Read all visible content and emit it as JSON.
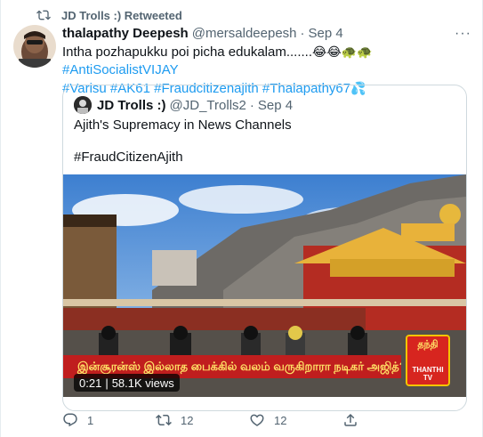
{
  "retweet": {
    "label": "JD Trolls :) Retweeted"
  },
  "tweet": {
    "author_name": "thalapathy Deepesh",
    "author_handle": "@mersaldeepesh",
    "separator": "·",
    "date": "Sep 4",
    "more": "···",
    "text_plain": "Intha pozhapukku poi picha edukalam.......",
    "emojis": "😂😂🐢🐢",
    "hashtags_line1": "#AntiSocialistVIJAY",
    "hashtags_line2": [
      "#Varisu",
      "#AK61",
      "#Fraudcitizenajith",
      "#Thalapathy67"
    ],
    "trailing_emoji": "💦"
  },
  "quoted": {
    "author_name": "JD Trolls :)",
    "author_handle": "@JD_Trolls2",
    "separator": "·",
    "date": "Sep 4",
    "text1": "Ajith's Supremacy in News Channels",
    "text2": "#FraudCitizenAjith",
    "video": {
      "caption": "இன்சூரன்ஸ் இல்லாத பைக்கில் வலம் வருகிறாரா நடிகர் அஜித்?",
      "logo_top": "தந்தி",
      "logo_bottom": "THANTHI TV",
      "duration": "0:21",
      "separator": "|",
      "views": "58.1K views"
    }
  },
  "actions": {
    "reply_count": "1",
    "retweet_count": "12",
    "like_count": "12"
  },
  "colors": {
    "link": "#1d9bf0",
    "muted": "#536471",
    "caption_bg": "#c01e1e"
  }
}
